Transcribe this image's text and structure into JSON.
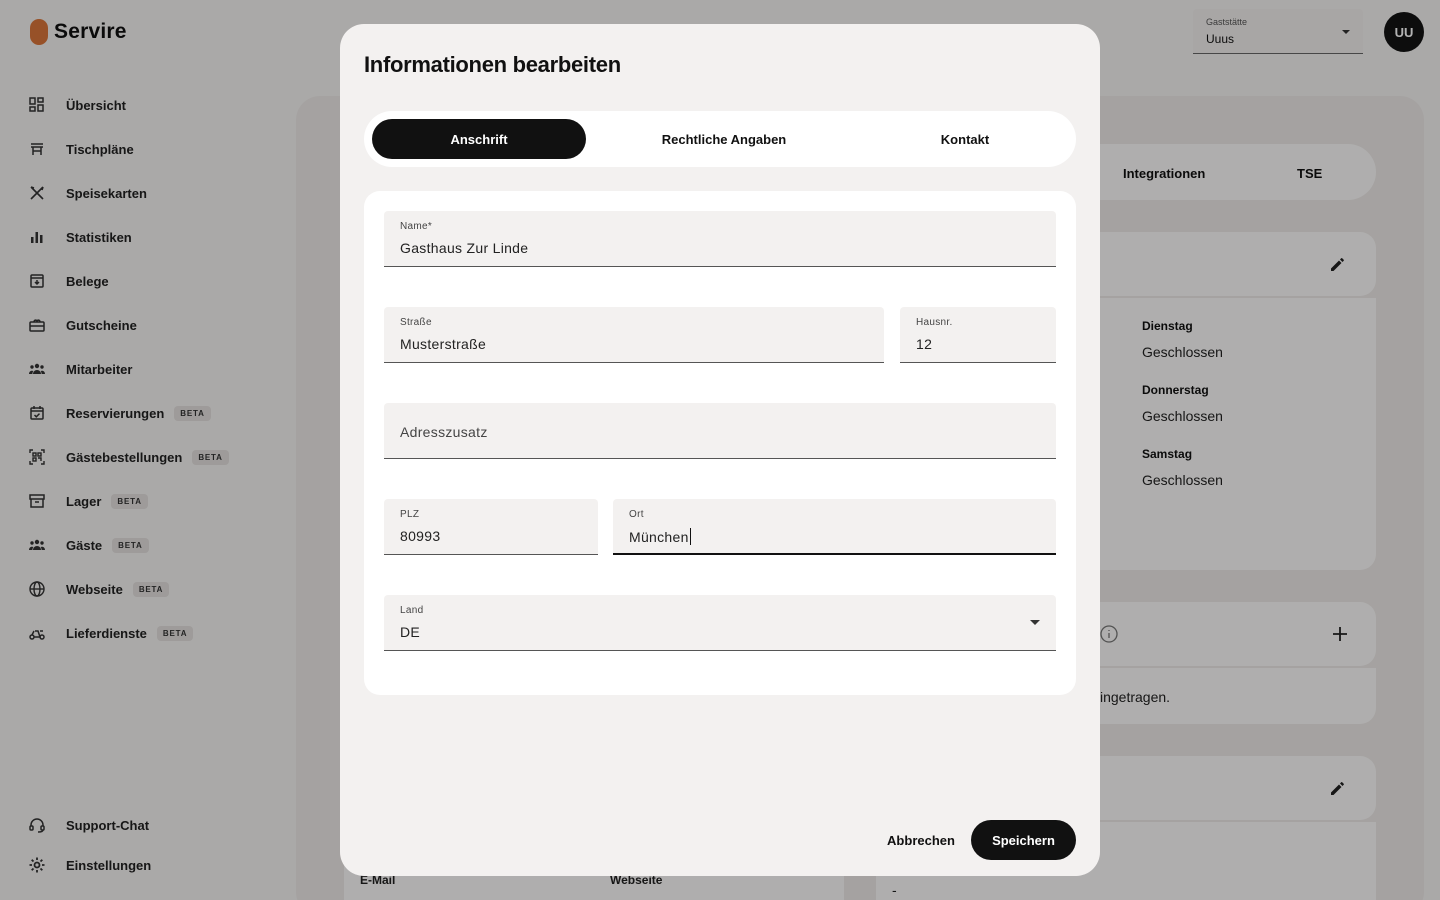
{
  "brand": {
    "name": "Servire",
    "accent": "#d9753a"
  },
  "sidebar": {
    "items": [
      {
        "label": "Übersicht",
        "icon": "dashboard-icon",
        "beta": ""
      },
      {
        "label": "Tischpläne",
        "icon": "table-icon",
        "beta": ""
      },
      {
        "label": "Speisekarten",
        "icon": "cutlery-icon",
        "beta": ""
      },
      {
        "label": "Statistiken",
        "icon": "bar-chart-icon",
        "beta": ""
      },
      {
        "label": "Belege",
        "icon": "receipt-icon",
        "beta": ""
      },
      {
        "label": "Gutscheine",
        "icon": "gift-icon",
        "beta": ""
      },
      {
        "label": "Mitarbeiter",
        "icon": "people-icon",
        "beta": ""
      },
      {
        "label": "Reservierungen",
        "icon": "calendar-icon",
        "beta": "BETA"
      },
      {
        "label": "Gästebestellungen",
        "icon": "qr-code-icon",
        "beta": "BETA"
      },
      {
        "label": "Lager",
        "icon": "archive-icon",
        "beta": "BETA"
      },
      {
        "label": "Gäste",
        "icon": "guests-icon",
        "beta": "BETA"
      },
      {
        "label": "Webseite",
        "icon": "globe-icon",
        "beta": "BETA"
      },
      {
        "label": "Lieferdienste",
        "icon": "scooter-icon",
        "beta": "BETA"
      }
    ],
    "bottom": [
      {
        "label": "Support-Chat",
        "icon": "headset-icon"
      },
      {
        "label": "Einstellungen",
        "icon": "gear-icon"
      }
    ]
  },
  "header": {
    "guesthouse_label": "Gaststätte",
    "guesthouse_value": "Uuus",
    "avatar_initials": "UU"
  },
  "background": {
    "tabs": [
      "Integrationen",
      "TSE"
    ],
    "days": [
      {
        "day": "Dienstag",
        "status": "Geschlossen"
      },
      {
        "day": "Donnerstag",
        "status": "Geschlossen"
      },
      {
        "day": "Samstag",
        "status": "Geschlossen"
      }
    ],
    "empty_text": "ingetragen.",
    "labels": {
      "email": "E-Mail",
      "website": "Webseite",
      "dash": "-"
    }
  },
  "modal": {
    "title": "Informationen bearbeiten",
    "tabs": [
      {
        "label": "Anschrift",
        "active": true
      },
      {
        "label": "Rechtliche Angaben",
        "active": false
      },
      {
        "label": "Kontakt",
        "active": false
      }
    ],
    "fields": {
      "name": {
        "label": "Name*",
        "value": "Gasthaus Zur Linde"
      },
      "street": {
        "label": "Straße",
        "value": "Musterstraße"
      },
      "house_number": {
        "label": "Hausnr.",
        "value": "12"
      },
      "address_extra": {
        "placeholder": "Adresszusatz"
      },
      "zip": {
        "label": "PLZ",
        "value": "80993"
      },
      "city": {
        "label": "Ort",
        "value": "München"
      },
      "country": {
        "label": "Land",
        "value": "DE"
      }
    },
    "cancel_label": "Abbrechen",
    "save_label": "Speichern"
  }
}
